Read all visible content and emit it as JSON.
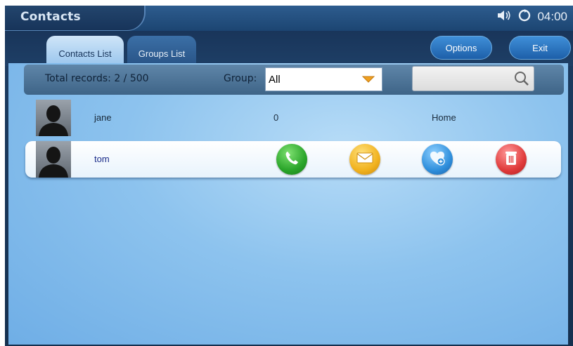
{
  "header": {
    "title": "Contacts",
    "time": "04:00",
    "icons": [
      "speaker-icon",
      "sync-status-icon"
    ]
  },
  "tabs": [
    {
      "label": "Contacts List",
      "active": true
    },
    {
      "label": "Groups List",
      "active": false
    }
  ],
  "actions": {
    "options_label": "Options",
    "exit_label": "Exit"
  },
  "toolbar": {
    "total_records": "Total records: 2 / 500",
    "group_label": "Group:",
    "group_value": "All",
    "search_value": "",
    "search_icon": "search-icon"
  },
  "contacts": [
    {
      "name": "jane",
      "number": "0",
      "type": "Home",
      "selected": false
    },
    {
      "name": "tom",
      "number": "",
      "type": "",
      "selected": true
    }
  ],
  "row_actions": [
    {
      "name": "call",
      "icon": "phone-icon",
      "color": "#2aa52a"
    },
    {
      "name": "message",
      "icon": "envelope-icon",
      "color": "#f1b21f"
    },
    {
      "name": "favorite",
      "icon": "heart-add-icon",
      "color": "#2f8fdc"
    },
    {
      "name": "delete",
      "icon": "trash-icon",
      "color": "#e03b3b"
    }
  ],
  "colors": {
    "titlebar": "#1c4572",
    "content_bg": "#8dc3ee",
    "selected_name": "#1b2d8a"
  }
}
